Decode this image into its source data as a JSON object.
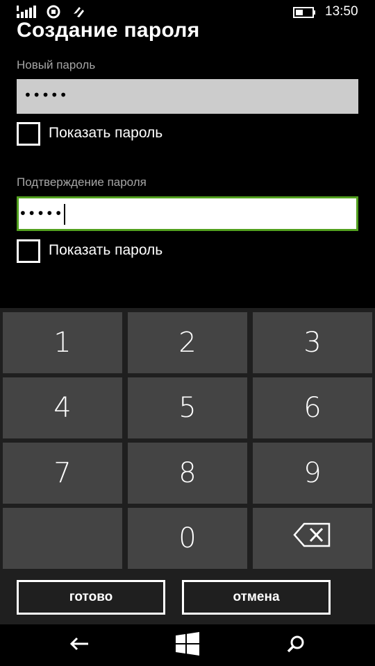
{
  "status_bar": {
    "time": "13:50",
    "icons": [
      "signal-icon",
      "rotation-lock-icon",
      "wifi-sense-icon",
      "battery-icon"
    ]
  },
  "page": {
    "title": "Создание пароля"
  },
  "new_password": {
    "label": "Новый пароль",
    "masked_value": "•••••",
    "show_label": "Показать пароль",
    "show_checked": false
  },
  "confirm_password": {
    "label": "Подтверждение пароля",
    "masked_value": "•••••",
    "show_label": "Показать пароль",
    "show_checked": false,
    "focused": true
  },
  "keypad": {
    "keys": [
      "1",
      "2",
      "3",
      "4",
      "5",
      "6",
      "7",
      "8",
      "9",
      "",
      "0",
      "backspace-icon"
    ]
  },
  "actions": {
    "done_label": "готово",
    "cancel_label": "отмена"
  },
  "nav": {
    "icons": [
      "back-icon",
      "windows-start-icon",
      "search-icon"
    ]
  },
  "colors": {
    "accent": "#52a01f",
    "background": "#000000",
    "key": "#444444",
    "keypad_bg": "#1f1f1f",
    "field_inactive": "#cccccc",
    "label": "#a6a6a6"
  }
}
